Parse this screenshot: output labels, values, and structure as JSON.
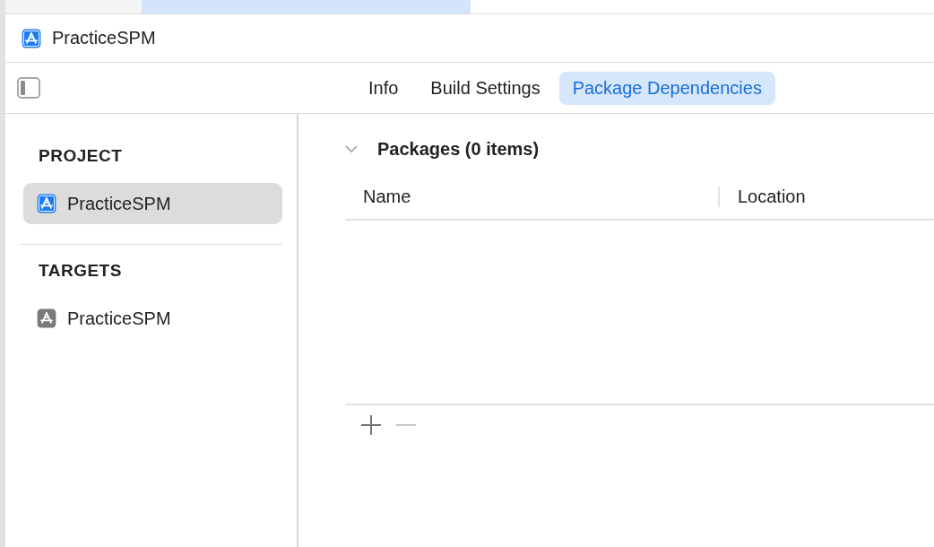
{
  "header": {
    "title": "PracticeSPM"
  },
  "tabs": [
    {
      "label": "Info",
      "selected": false
    },
    {
      "label": "Build Settings",
      "selected": false
    },
    {
      "label": "Package Dependencies",
      "selected": true
    }
  ],
  "sidebar": {
    "sections": [
      {
        "title": "PROJECT",
        "kind": "project",
        "items": [
          {
            "label": "PracticeSPM",
            "selected": true
          }
        ]
      },
      {
        "title": "TARGETS",
        "kind": "target",
        "items": [
          {
            "label": "PracticeSPM",
            "selected": false
          }
        ]
      }
    ]
  },
  "packages": {
    "title": "Packages (0 items)",
    "expanded": true,
    "columns": [
      "Name",
      "Location"
    ],
    "add_button": {
      "disabled": false
    },
    "remove_button": {
      "disabled": true
    }
  }
}
